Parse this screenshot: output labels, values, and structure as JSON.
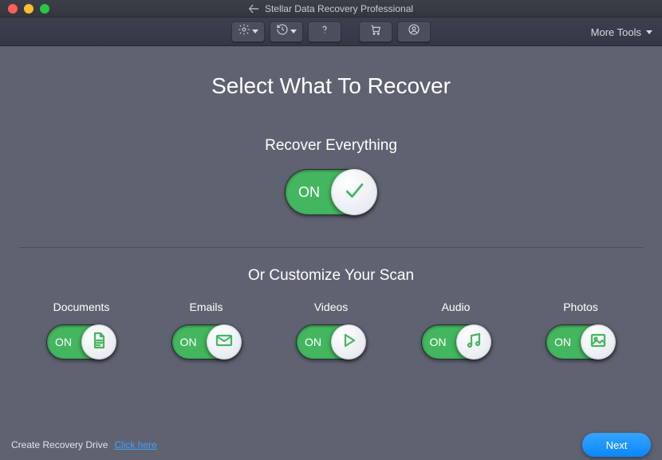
{
  "window": {
    "title": "Stellar Data Recovery Professional"
  },
  "toolbar": {
    "more_tools_label": "More Tools"
  },
  "main": {
    "heading": "Select What To Recover",
    "recover_everything_label": "Recover Everything",
    "customize_label": "Or Customize Your Scan",
    "on_label": "ON"
  },
  "options": {
    "documents": {
      "label": "Documents",
      "on_label": "ON"
    },
    "emails": {
      "label": "Emails",
      "on_label": "ON"
    },
    "videos": {
      "label": "Videos",
      "on_label": "ON"
    },
    "audio": {
      "label": "Audio",
      "on_label": "ON"
    },
    "photos": {
      "label": "Photos",
      "on_label": "ON"
    }
  },
  "footer": {
    "create_recovery_label": "Create Recovery Drive",
    "click_here_label": "Click here",
    "next_label": "Next"
  }
}
